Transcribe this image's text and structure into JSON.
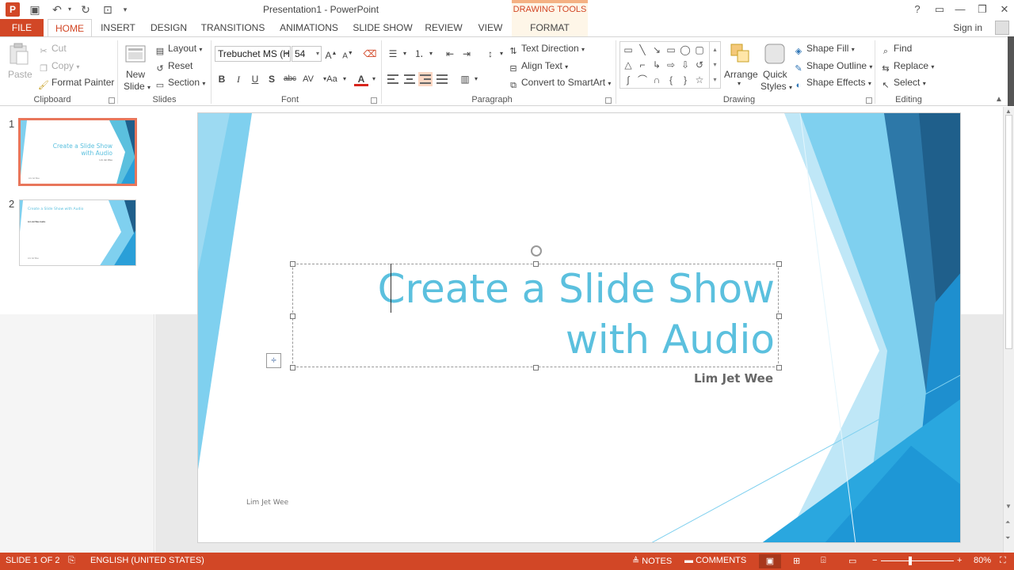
{
  "window": {
    "title": "Presentation1 - PowerPoint",
    "contextual_tab_group": "DRAWING TOOLS",
    "help": "?",
    "ribbon_display": "▭",
    "minimize": "—",
    "restore": "❐",
    "close": "✕"
  },
  "tabs": [
    {
      "label": "FILE"
    },
    {
      "label": "HOME"
    },
    {
      "label": "INSERT"
    },
    {
      "label": "DESIGN"
    },
    {
      "label": "TRANSITIONS"
    },
    {
      "label": "ANIMATIONS"
    },
    {
      "label": "SLIDE SHOW"
    },
    {
      "label": "REVIEW"
    },
    {
      "label": "VIEW"
    },
    {
      "label": "FORMAT"
    }
  ],
  "sign_in": "Sign in",
  "ribbon": {
    "clipboard": {
      "label": "Clipboard",
      "paste": "Paste",
      "cut": "Cut",
      "copy": "Copy",
      "format_painter": "Format Painter"
    },
    "slides": {
      "label": "Slides",
      "new_slide_line1": "New",
      "new_slide_line2": "Slide",
      "layout": "Layout",
      "reset": "Reset",
      "section": "Section"
    },
    "font": {
      "label": "Font",
      "font_name": "Trebuchet MS (H",
      "font_size": "54",
      "bold": "B",
      "italic": "I",
      "underline": "U",
      "shadow": "S",
      "strike": "abc",
      "spacing": "AV",
      "case": "Aa",
      "color": "A"
    },
    "paragraph": {
      "label": "Paragraph",
      "text_direction": "Text Direction",
      "align_text": "Align Text",
      "convert_smartart": "Convert to SmartArt"
    },
    "drawing": {
      "label": "Drawing",
      "arrange": "Arrange",
      "quick_styles_line1": "Quick",
      "quick_styles_line2": "Styles",
      "shape_fill": "Shape Fill",
      "shape_outline": "Shape Outline",
      "shape_effects": "Shape Effects"
    },
    "editing": {
      "label": "Editing",
      "find": "Find",
      "replace": "Replace",
      "select": "Select"
    }
  },
  "thumbnails": [
    {
      "number": "1",
      "title": "Create a Slide Show with Audio",
      "subtitle": "Lim Jet Wee",
      "footer": "Lim Jet Wee"
    },
    {
      "number": "2",
      "title": "Create a Slide Show with Audio",
      "body": "Lim Jet Wee Audio",
      "footer": "Lim Jet Wee"
    }
  ],
  "slide": {
    "title_line1": "Create a Slide Show",
    "title_line2": "with Audio",
    "subtitle": "Lim Jet Wee",
    "footer": "Lim Jet Wee"
  },
  "status": {
    "slide_info": "SLIDE 1 OF 2",
    "language": "ENGLISH (UNITED STATES)",
    "notes": "NOTES",
    "comments": "COMMENTS",
    "zoom": "80%"
  },
  "colors": {
    "accent": "#d24726",
    "title_text": "#5bc0de",
    "slide_blue_light": "#7fd0ef",
    "slide_blue_dark": "#1f5f8b"
  }
}
